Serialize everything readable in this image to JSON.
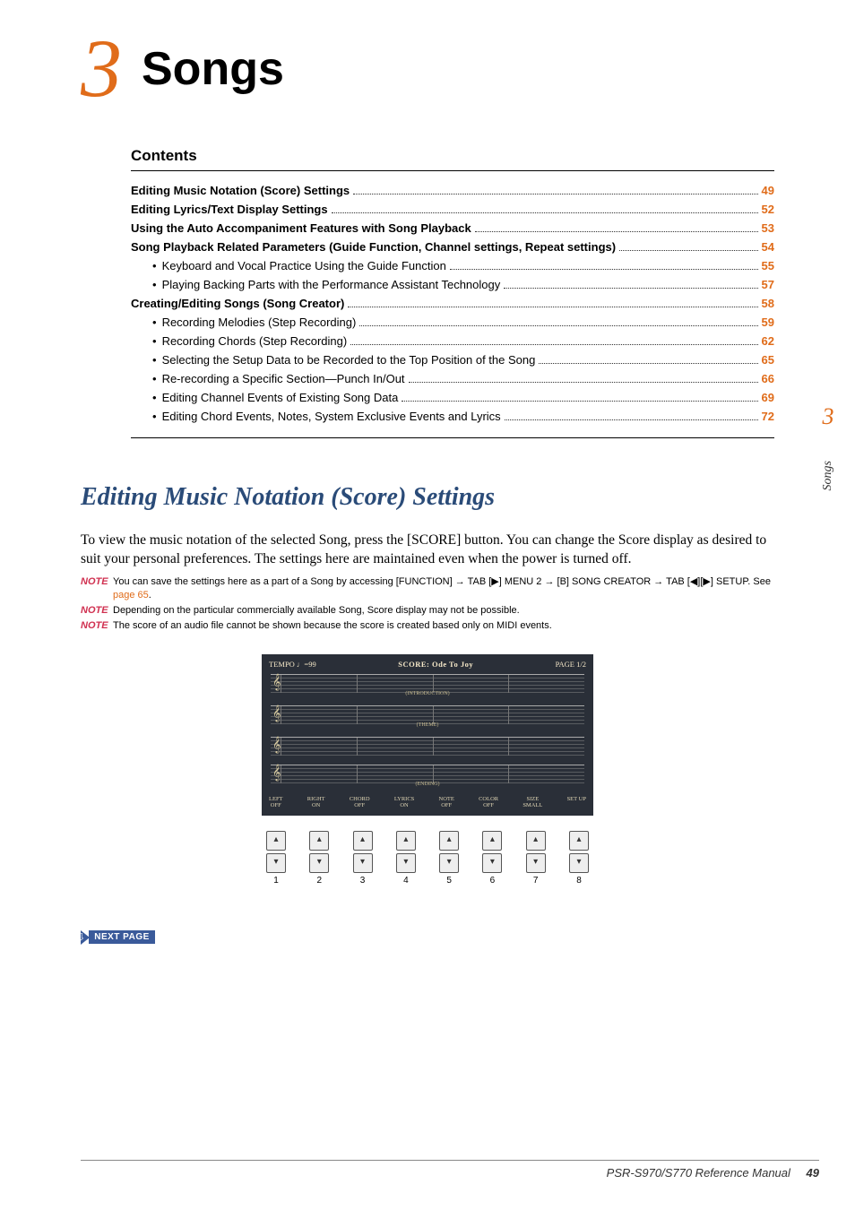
{
  "chapter": {
    "number": "3",
    "title": "Songs"
  },
  "contents_heading": "Contents",
  "toc": [
    {
      "label": "Editing Music Notation (Score) Settings",
      "page": "49",
      "bold": true
    },
    {
      "label": "Editing Lyrics/Text Display Settings",
      "page": "52",
      "bold": true
    },
    {
      "label": "Using the Auto Accompaniment Features with Song Playback",
      "page": "53",
      "bold": true
    },
    {
      "label": "Song Playback Related Parameters (Guide Function, Channel settings, Repeat settings)",
      "page": "54",
      "bold": true
    },
    {
      "label": "Keyboard and Vocal Practice Using the Guide Function",
      "page": "55",
      "bold": false
    },
    {
      "label": "Playing Backing Parts with the Performance Assistant Technology",
      "page": "57",
      "bold": false
    },
    {
      "label": "Creating/Editing Songs (Song Creator)",
      "page": "58",
      "bold": true
    },
    {
      "label": "Recording Melodies (Step Recording)",
      "page": "59",
      "bold": false
    },
    {
      "label": "Recording Chords (Step Recording)",
      "page": "62",
      "bold": false
    },
    {
      "label": "Selecting the Setup Data to be Recorded to the Top Position of the Song",
      "page": "65",
      "bold": false
    },
    {
      "label": "Re-recording a Specific Section—Punch In/Out",
      "page": "66",
      "bold": false
    },
    {
      "label": "Editing Channel Events of Existing Song Data",
      "page": "69",
      "bold": false
    },
    {
      "label": "Editing Chord Events, Notes, System Exclusive Events and Lyrics",
      "page": "72",
      "bold": false
    }
  ],
  "section_title": "Editing Music Notation (Score) Settings",
  "body_text": "To view the music notation of the selected Song, press the [SCORE] button. You can change the Score display as desired to suit your personal preferences. The settings here are maintained even when the power is turned off.",
  "notes": [
    {
      "text_before": "You can save the settings here as a part of a Song by accessing [FUNCTION] → TAB [▶] MENU 2 → [B] SONG CREATOR → TAB [◀][▶] SETUP. See ",
      "link": "page 65",
      "text_after": "."
    },
    {
      "text_before": "Depending on the particular commercially available Song, Score display may not be possible.",
      "link": "",
      "text_after": ""
    },
    {
      "text_before": "The score of an audio file cannot be shown because the score is created based only on MIDI events.",
      "link": "",
      "text_after": ""
    }
  ],
  "note_label": "NOTE",
  "score_screen": {
    "tempo": "TEMPO ♩=99",
    "title": "SCORE: Ode To Joy",
    "page": "PAGE 1/2",
    "staff_labels": [
      "(INTRODUCTION)",
      "(THEME)",
      "",
      "(ENDING)"
    ],
    "bottom_labels": [
      {
        "l1": "LEFT",
        "l2": "OFF"
      },
      {
        "l1": "RIGHT",
        "l2": "ON"
      },
      {
        "l1": "CHORD",
        "l2": "OFF"
      },
      {
        "l1": "LYRICS",
        "l2": "ON"
      },
      {
        "l1": "NOTE",
        "l2": "OFF"
      },
      {
        "l1": "COLOR",
        "l2": "OFF"
      },
      {
        "l1": "SIZE",
        "l2": "SMALL"
      },
      {
        "l1": "SET UP",
        "l2": ""
      }
    ]
  },
  "buttons": [
    "1",
    "2",
    "3",
    "4",
    "5",
    "6",
    "7",
    "8"
  ],
  "next_page_label": "NEXT PAGE",
  "side_tab": {
    "num": "3",
    "name": "Songs"
  },
  "footer": {
    "manual": "PSR-S970/S770 Reference Manual",
    "page": "49"
  }
}
